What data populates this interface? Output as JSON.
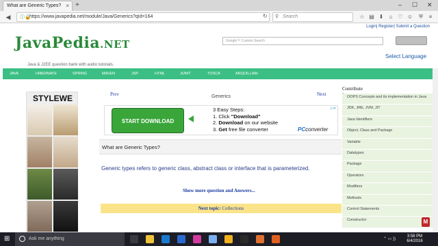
{
  "browser": {
    "tab_title": "What are Generic Types?",
    "tab_close": "×",
    "new_tab": "+",
    "url": "https://www.javapedia.net/module/Java/Generics?qId=164",
    "search_placeholder": "Search",
    "icons": [
      "back-icon",
      "info-icon",
      "reload-icon",
      "search-icon",
      "star-icon",
      "reader-icon",
      "download-icon",
      "home-icon",
      "pocket-icon",
      "menu-icon"
    ]
  },
  "site": {
    "logo_main": "JavaPedia",
    "logo_suffix": ".NET",
    "tagline": "Java & J2EE question bank with audio tutorials.",
    "top_links": "Login| Register| Submit a Question",
    "search_placeholder": "Google™ Custom Search",
    "select_language": "Select Language",
    "menu": [
      "JAVA",
      "HIBERNATE",
      "SPRING",
      "MAVEN",
      "JSP",
      "HTML",
      "JUNIT",
      "TOSCA",
      "ARQUILLIAN"
    ]
  },
  "left_ad": {
    "brand": "STYLEWE"
  },
  "content": {
    "prev": "Prev",
    "next": "Next",
    "topic": "Generics",
    "ad": {
      "button": "START DOWNLOAD",
      "heading": "3 Easy Steps:",
      "step1_prefix": "1. Click ",
      "step1_bold": "\"Download\"",
      "step2_prefix": "2. ",
      "step2_bold": "Download",
      "step2_suffix": " on our website",
      "step3_prefix": "3. ",
      "step3_bold": "Get",
      "step3_suffix": " free file converter",
      "brand_pc": "PC",
      "brand_rest": "converter",
      "ad_choices": "▷✕"
    },
    "question": "What are Generic Types?",
    "answer": "Generic types refers to generic class, abstract class or interface that is parameterized.",
    "show_more": "Show more question and Answers...",
    "next_topic_label": "Next topic:",
    "next_topic_value": "Collections"
  },
  "sidebar": {
    "title": "Contribute",
    "marker": "a",
    "items": [
      "OOPS Concepts and its implementation in Java",
      "JDK, JRE, JVM, JIT",
      "Java Identifiers",
      "Object, Class and Package",
      "Variable",
      "Datatypes",
      "Package",
      "Operators",
      "Modifiers",
      "Methods",
      "Control Statements",
      "Constructor"
    ]
  },
  "taskbar": {
    "cortana_placeholder": "Ask me anything",
    "time": "3:58 PM",
    "date": "6/4/2016",
    "app_colors": [
      "#3a3a42",
      "#f0c23a",
      "#1a78d0",
      "#2a6ad0",
      "#d23aa0",
      "#7ab0f0",
      "#f0b020",
      "#2a2a2a",
      "#e07030",
      "#e06020"
    ]
  }
}
